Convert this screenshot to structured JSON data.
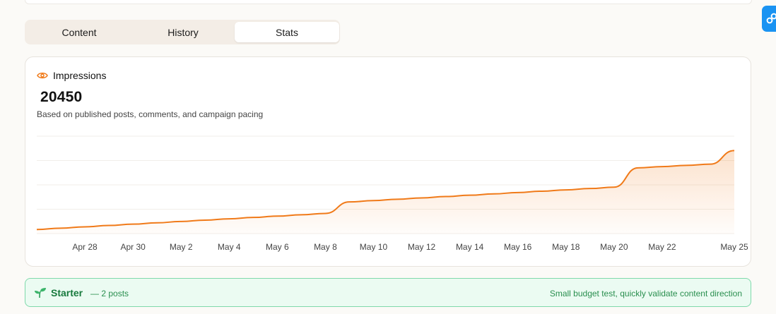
{
  "tabs": [
    {
      "label": "Content",
      "active": false
    },
    {
      "label": "History",
      "active": false
    },
    {
      "label": "Stats",
      "active": true
    }
  ],
  "metric": {
    "icon": "eye-icon",
    "label": "Impressions",
    "value": "20450",
    "subtitle": "Based on published posts, comments, and campaign pacing"
  },
  "colors": {
    "accent": "#f07a19",
    "tier_text": "#177a3d",
    "tier_border": "#7fd9ab"
  },
  "chart_data": {
    "type": "area",
    "x": [
      "Apr 26",
      "Apr 27",
      "Apr 28",
      "Apr 29",
      "Apr 30",
      "May 1",
      "May 2",
      "May 3",
      "May 4",
      "May 5",
      "May 6",
      "May 7",
      "May 8",
      "May 9",
      "May 10",
      "May 11",
      "May 12",
      "May 13",
      "May 14",
      "May 15",
      "May 16",
      "May 17",
      "May 18",
      "May 19",
      "May 20",
      "May 21",
      "May 22",
      "May 23",
      "May 24",
      "May 25"
    ],
    "values": [
      1000,
      1330,
      1660,
      1990,
      2320,
      2650,
      2980,
      3310,
      3640,
      3970,
      4300,
      4630,
      4960,
      7800,
      8130,
      8460,
      8790,
      9120,
      9450,
      9780,
      10110,
      10440,
      10770,
      11100,
      11430,
      16200,
      16500,
      16800,
      17100,
      20450
    ],
    "x_tick_labels": [
      "Apr 28",
      "Apr 30",
      "May 2",
      "May 4",
      "May 6",
      "May 8",
      "May 10",
      "May 12",
      "May 14",
      "May 16",
      "May 18",
      "May 20",
      "May 22",
      "May 25"
    ],
    "ylim": [
      0,
      24000
    ],
    "grid": true,
    "y_axis_labels": false,
    "legend": "none"
  },
  "tier": {
    "icon": "sprout-icon",
    "name": "Starter",
    "count": "— 2 posts",
    "description": "Small budget test, quickly validate content direction"
  }
}
